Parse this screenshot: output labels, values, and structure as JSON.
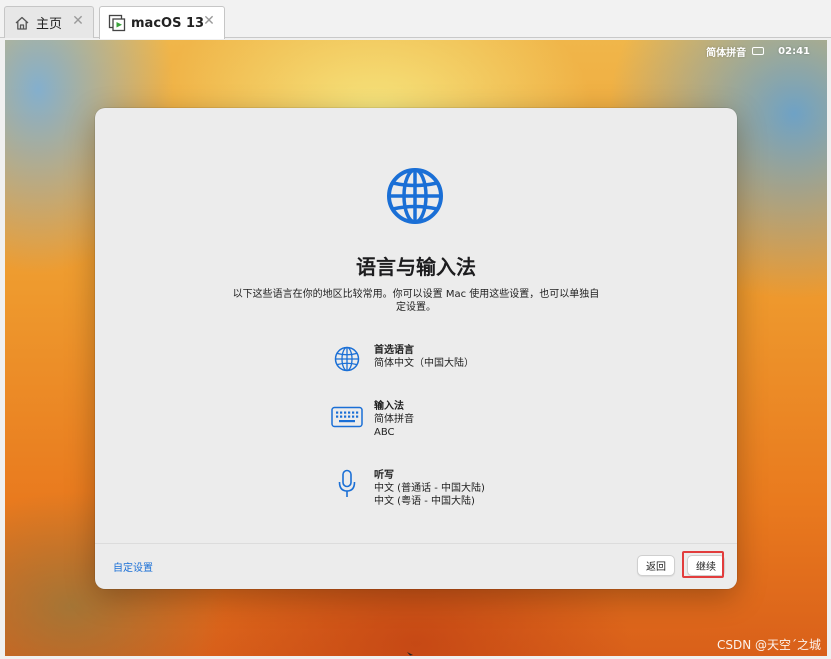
{
  "tabs": [
    {
      "label": "主页",
      "icon": "home-icon",
      "close_icon": "close-icon"
    },
    {
      "label": "macOS 13",
      "icon": "vm-play-icon",
      "close_icon": "close-icon"
    }
  ],
  "menubar": {
    "input_method": "简体拼音",
    "input_icon": "keyboard-icon",
    "clock": "02:41"
  },
  "dialog": {
    "icon": "globe-icon",
    "title": "语言与输入法",
    "description": "以下这些语言在你的地区比较常用。你可以设置 Mac 使用这些设置，也可以单独自定设置。",
    "items": [
      {
        "icon": "globe-icon",
        "title": "首选语言",
        "lines": [
          "简体中文（中国大陆）"
        ]
      },
      {
        "icon": "keyboard-icon",
        "title": "输入法",
        "lines": [
          "简体拼音",
          "ABC"
        ]
      },
      {
        "icon": "microphone-icon",
        "title": "听写",
        "lines": [
          "中文 (普通话 - 中国大陆)",
          "中文 (粤语 - 中国大陆)"
        ]
      }
    ],
    "customize_link": "自定设置",
    "back_button": "返回",
    "continue_button": "继续"
  },
  "watermark": "CSDN @天空´之城",
  "colors": {
    "accent": "#1a6fd6",
    "highlight": "#e23d3d"
  }
}
